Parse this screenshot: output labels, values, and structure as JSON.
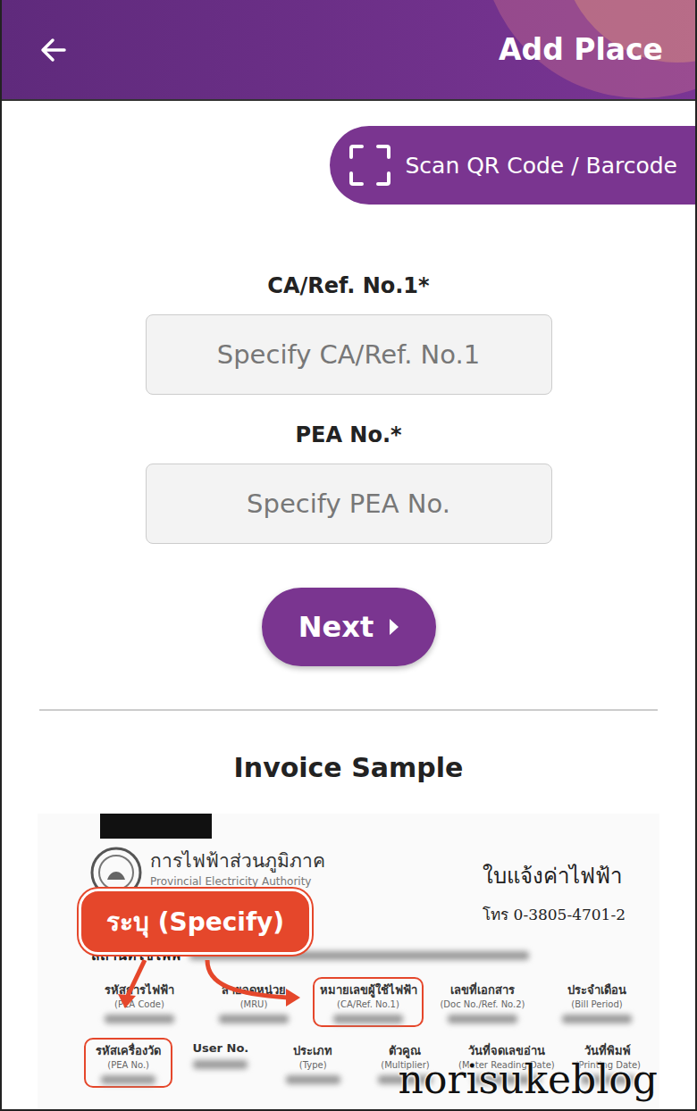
{
  "header": {
    "title": "Add Place"
  },
  "scan_button": {
    "label": "Scan QR Code / Barcode"
  },
  "fields": [
    {
      "label": "CA/Ref. No.1*",
      "placeholder": "Specify CA/Ref. No.1"
    },
    {
      "label": "PEA No.*",
      "placeholder": "Specify PEA No."
    }
  ],
  "next_button": {
    "label": "Next"
  },
  "invoice_sample": {
    "title": "Invoice Sample",
    "authority_th": "การไฟฟ้าส่วนภูมิภาค",
    "authority_en": "Provincial Electricity Authority",
    "doc_title": "ใบแจ้งค่าไฟฟ้า",
    "phone": "โทร 0-3805-4701-2",
    "callout": "ระบุ (Specify)",
    "place_label": "สถานที่ใช้ไฟฟ",
    "header_rows": [
      [
        {
          "th": "รหัสการไฟฟ้า",
          "en": "(PEA Code)",
          "circled": false
        },
        {
          "th": "สายจดหน่วย",
          "en": "(MRU)",
          "circled": false
        },
        {
          "th": "หมายเลขผู้ใช้ไฟฟ้า",
          "en": "(CA/Ref. No.1)",
          "circled": true
        },
        {
          "th": "เลขที่เอกสาร",
          "en": "(Doc No./Ref. No.2)",
          "circled": false
        },
        {
          "th": "ประจำเดือน",
          "en": "(Bill Period)",
          "circled": false
        }
      ],
      [
        {
          "th": "รหัสเครื่องวัด",
          "en": "(PEA No.)",
          "circled": true
        },
        {
          "th": "User No.",
          "en": "",
          "circled": false
        },
        {
          "th": "ประเภท",
          "en": "(Type)",
          "circled": false
        },
        {
          "th": "ตัวคูณ",
          "en": "(Multiplier)",
          "circled": false
        },
        {
          "th": "วันที่จดเลขอ่าน",
          "en": "(Meter Reading Date)",
          "circled": false
        },
        {
          "th": "วันที่พิมพ์",
          "en": "(Printing Date)",
          "circled": false
        }
      ]
    ]
  },
  "watermark": "norisukeblog"
}
